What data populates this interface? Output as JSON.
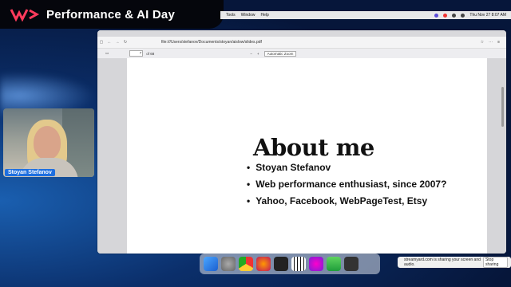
{
  "event": {
    "title": "Performance & AI Day"
  },
  "camera": {
    "speaker_name": "Stoyan Stefanov"
  },
  "menubar": {
    "items": [
      "Tools",
      "Window",
      "Help"
    ],
    "clock": "Thu Nov 27  8:07 AM"
  },
  "browser": {
    "url": "file:///Users/stefanov/Documents/stoyan/aislow/slides.pdf",
    "pdf": {
      "page": "7",
      "of_pages": "of 68",
      "zoom": "Automatic Zoom"
    }
  },
  "slide": {
    "title": "About me",
    "bullets": [
      "Stoyan Stefanov",
      "Web performance enthusiast, since 2007?",
      "Yahoo, Facebook, WebPageTest, Etsy"
    ]
  },
  "notification": {
    "text": "streamyard.com is sharing your screen and audio.",
    "stop_label": "Stop sharing"
  },
  "dock_apps": [
    "finder-icon",
    "settings-icon",
    "chrome-icon",
    "firefox-icon",
    "terminal-icon",
    "piano-icon",
    "flower-icon",
    "numbers-icon",
    "cube-icon"
  ]
}
